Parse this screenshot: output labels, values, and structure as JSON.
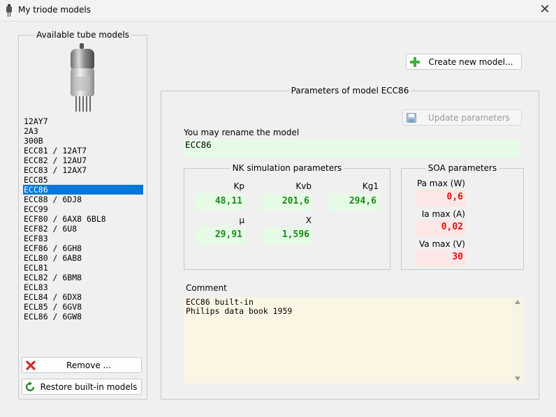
{
  "window": {
    "title": "My triode models",
    "close_glyph": "✕"
  },
  "left_panel": {
    "legend": "Available tube models",
    "models": [
      "12AY7",
      "2A3",
      "300B",
      "ECC81 / 12AT7",
      "ECC82 / 12AU7",
      "ECC83 / 12AX7",
      "ECC85",
      "ECC86",
      "ECC88 / 6DJ8",
      "ECC99",
      "ECF80 / 6AX8 6BL8",
      "ECF82 / 6U8",
      "ECF83",
      "ECF86 / 6GH8",
      "ECL80 / 6AB8",
      "ECL81",
      "ECL82 / 6BM8",
      "ECL83",
      "ECL84 / 6DX8",
      "ECL85 / 6GV8",
      "ECL86 / 6GW8"
    ],
    "selected_index": 7,
    "remove_label": "Remove ...",
    "restore_label": "Restore built-in models"
  },
  "create_label": "Create new model...",
  "params": {
    "legend": "Parameters of model ECC86",
    "update_label": "Update parameters",
    "rename_label": "You may rename the model",
    "model_name": "ECC86",
    "nk": {
      "legend": "NK simulation parameters",
      "kp_label": "Kp",
      "kp": "48,11",
      "kvb_label": "Kvb",
      "kvb": "201,6",
      "kg1_label": "Kg1",
      "kg1": "294,6",
      "mu_label": "μ",
      "mu": "29,91",
      "x_label": "X",
      "x": "1,596"
    },
    "soa": {
      "legend": "SOA parameters",
      "pa_label": "Pa max (W)",
      "pa": "0,6",
      "ia_label": "Ia max (A)",
      "ia": "0,02",
      "va_label": "Va max (V)",
      "va": "30"
    },
    "comment_label": "Comment",
    "comment": "ECC86 built-in\nPhilips data book 1959"
  },
  "colors": {
    "selection": "#0078d7",
    "green_value": "#1b8a1b",
    "red_value": "#e01010"
  }
}
